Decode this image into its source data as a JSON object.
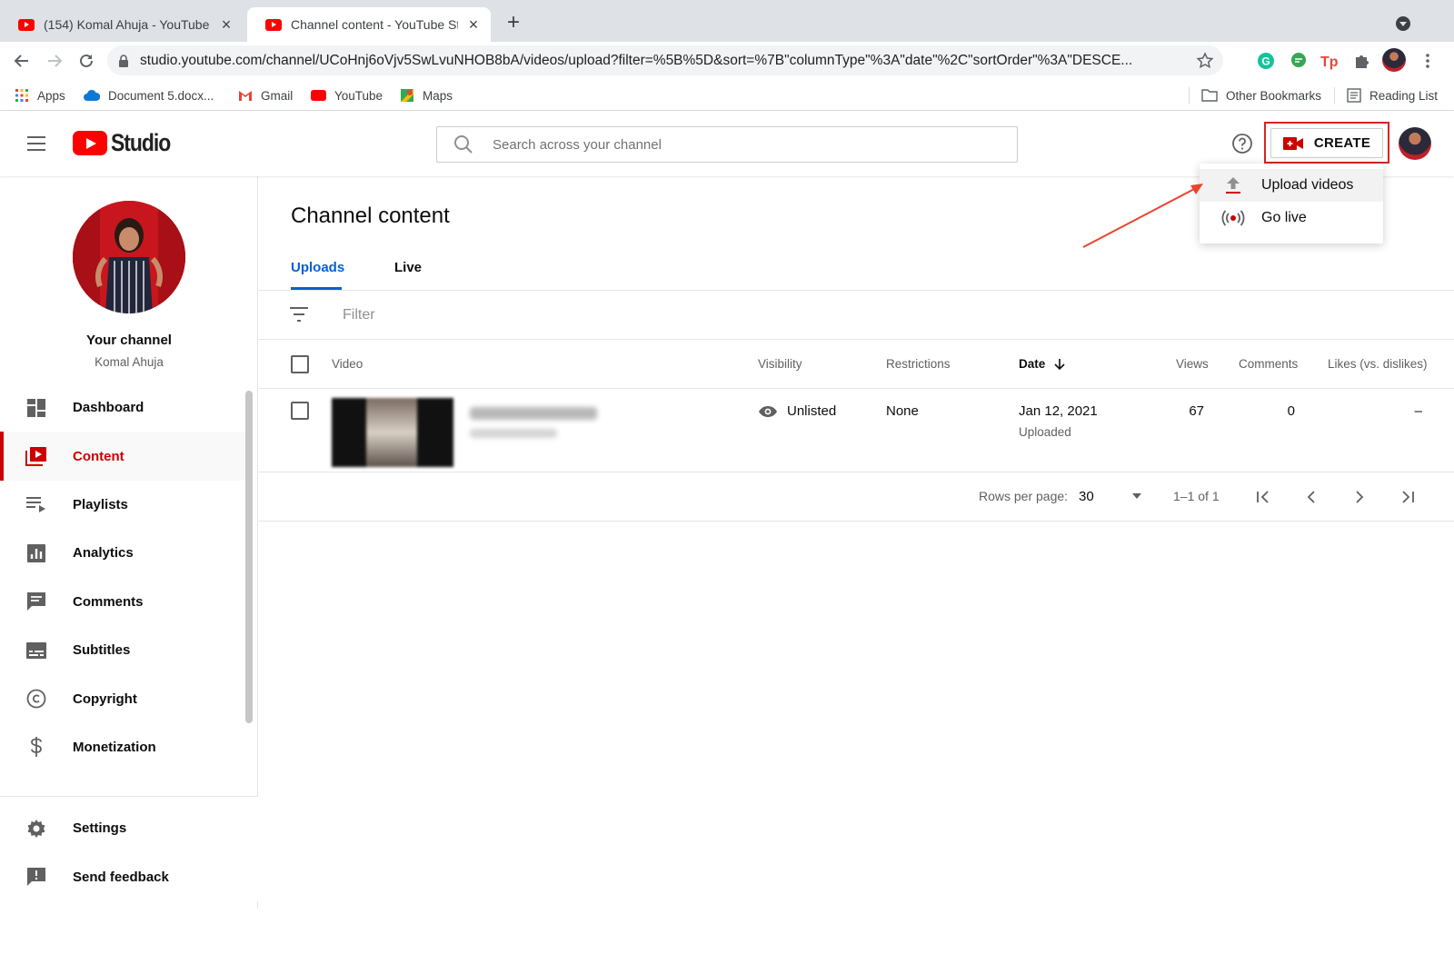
{
  "browser": {
    "tabs": [
      {
        "title": "(154) Komal Ahuja - YouTube",
        "active": false
      },
      {
        "title": "Channel content - YouTube Studio",
        "active": true
      }
    ],
    "url": "studio.youtube.com/channel/UCoHnj6oVjv5SwLvuNHOB8bA/videos/upload?filter=%5B%5D&sort=%7B\"columnType\"%3A\"date\"%2C\"sortOrder\"%3A\"DESCE...",
    "bookmarks": {
      "apps": "Apps",
      "doc": "Document 5.docx...",
      "gmail": "Gmail",
      "youtube": "YouTube",
      "maps": "Maps",
      "other": "Other Bookmarks",
      "reading": "Reading List"
    }
  },
  "header": {
    "logo_text": "Studio",
    "search_placeholder": "Search across your channel",
    "create_label": "CREATE"
  },
  "create_menu": {
    "upload": "Upload videos",
    "live": "Go live"
  },
  "sidebar": {
    "your_channel": "Your channel",
    "channel_name": "Komal Ahuja",
    "items": [
      {
        "label": "Dashboard",
        "icon": "dashboard-icon"
      },
      {
        "label": "Content",
        "icon": "content-icon",
        "active": true
      },
      {
        "label": "Playlists",
        "icon": "playlists-icon"
      },
      {
        "label": "Analytics",
        "icon": "analytics-icon"
      },
      {
        "label": "Comments",
        "icon": "comments-icon"
      },
      {
        "label": "Subtitles",
        "icon": "subtitles-icon"
      },
      {
        "label": "Copyright",
        "icon": "copyright-icon"
      },
      {
        "label": "Monetization",
        "icon": "monetization-icon"
      }
    ],
    "bottom": [
      {
        "label": "Settings",
        "icon": "gear-icon"
      },
      {
        "label": "Send feedback",
        "icon": "feedback-icon"
      }
    ]
  },
  "main": {
    "title": "Channel content",
    "tabs": [
      "Uploads",
      "Live"
    ],
    "filter_placeholder": "Filter",
    "columns": {
      "video": "Video",
      "visibility": "Visibility",
      "restrictions": "Restrictions",
      "date": "Date",
      "views": "Views",
      "comments": "Comments",
      "likes": "Likes (vs. dislikes)"
    },
    "rows": [
      {
        "visibility": "Unlisted",
        "restrictions": "None",
        "date": "Jan 12, 2021",
        "date_status": "Uploaded",
        "views": "67",
        "comments": "0",
        "likes": "–"
      }
    ],
    "pagination": {
      "rows_per_page_label": "Rows per page:",
      "rows_per_page": "30",
      "range": "1–1 of 1"
    }
  },
  "colors": {
    "brand_red": "#ff0000",
    "active_red": "#cc0000",
    "link_blue": "#065fd4",
    "annotation_red": "#d92323"
  }
}
